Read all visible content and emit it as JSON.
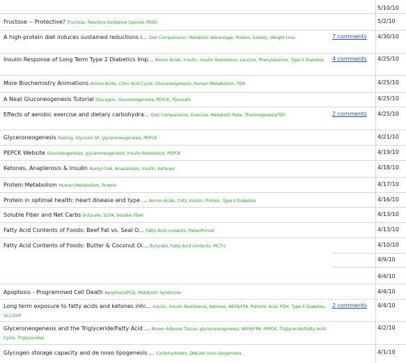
{
  "rows": [
    {
      "title": "Fructose -- Protective?",
      "tags": "Fructose, Reactive Oxidative Species (ROS)",
      "comments": "",
      "date": "5/2/10"
    },
    {
      "title": "A high-protein diet induces sustained reductions i...",
      "tags": "Diet Comparisons, Metabolic Advantage, Protein, Satiety, Weight Loss",
      "comments": "7 comments",
      "date": "4/30/10"
    },
    {
      "title": "Insulin Response of Long Term Type 2 Diabetics Imp...",
      "tags": "Amino Acids, Insulin, Insulin Resistance, Leucine, Phenylalanine, Type II Diabetes",
      "comments": "4 comments",
      "date": "4/25/10"
    },
    {
      "title": "More Biochemistry Animations",
      "tags": "Amino Acids, Citric Acid Cycle, Gluconeogenesis, Human Metabolism, PDH",
      "comments": "",
      "date": "4/25/10"
    },
    {
      "title": "A Neat Gluconeogenesis Tutorial",
      "tags": "Glucagon, Gluconeogenesis, PEPCK, Pyruvate",
      "comments": "",
      "date": "4/25/10"
    },
    {
      "title": "Effects of aerobic exercise and dietary carbohydra...",
      "tags": "Diet Comparisons, Exercise, Metabolic Rate, Thermogenesis/TEF",
      "comments": "2 comments",
      "date": "4/25/10"
    },
    {
      "title": "Glyceroneogenesis",
      "tags": "Fasting, Glycerol 3P, glyceroneogenesis, PEPCK",
      "comments": "",
      "date": "4/21/10"
    },
    {
      "title": "PEPCK Website",
      "tags": "Gluconeogenesis, glyceroneogenesis, Insulin Resistance, PEPCK",
      "comments": "",
      "date": "4/19/10"
    },
    {
      "title": "Ketones, Anaplerosis & Insulin",
      "tags": "Acetyl-CoA, Anaplerosis, Insulin, Ketones",
      "comments": "",
      "date": "4/18/10"
    },
    {
      "title": "Protein Metabolism",
      "tags": "Human Metabolism, Protein",
      "comments": "",
      "date": "4/17/10"
    },
    {
      "title": "Protein in optimal health: heart disease and type ...",
      "tags": "Amino Acids, CVD, Insulin, Protein, Type II Diabetes",
      "comments": "",
      "date": "4/16/10"
    },
    {
      "title": "Soluble Fiber and Net Carbs",
      "tags": "Butyrate, SCFA, Soluble Fiber",
      "comments": "",
      "date": "4/13/10"
    },
    {
      "title": "Fatty Acid Contents of Foods: Beef Fat vs. Seal O...",
      "tags": "Fatty Acid contents, Paleo/Primal",
      "comments": "",
      "date": "4/13/10"
    },
    {
      "title": "Fatty Acid Contents of Foods: Butter & Coconut Oi...",
      "tags": "Butyrate, Fatty Acid contents, MCT's",
      "comments": "",
      "date": "4/10/10"
    },
    {
      "title": "Apoptosis - Programmed Cell Death",
      "tags": "Apoptosis/PCD, Metabolic Syndrome",
      "comments": "",
      "date": "4/4/10"
    },
    {
      "title": "Long term exposure to fatty acids and ketones inhi...",
      "tags": "Insulin, Insulin Resistance, Ketones, NEFA/FFA, Palmitic Acid, PDH, Type II Diabetes, VLC/VHF",
      "comments": "2 comments",
      "date": "4/4/10"
    },
    {
      "title": "Glyceroneogenesis and the Triglyceride/Fatty Acid ...",
      "tags": "Brown Adipose Tissue, glyceroneogenesis, NEFA/FFA, PEPCK, Triglyceride/Fatty Acid Cycle, Triglycerides",
      "comments": "",
      "date": "4/2/10"
    },
    {
      "title": "Glycogen storage capacity and de novo lipogenesis ...",
      "tags": "Carbohydrates, DNL/de novo lipogenesis",
      "comments": "",
      "date": "4/1/10"
    }
  ],
  "top_date": "5/10/10",
  "extra_dates": [
    "4/9/10",
    "4/4/10"
  ]
}
